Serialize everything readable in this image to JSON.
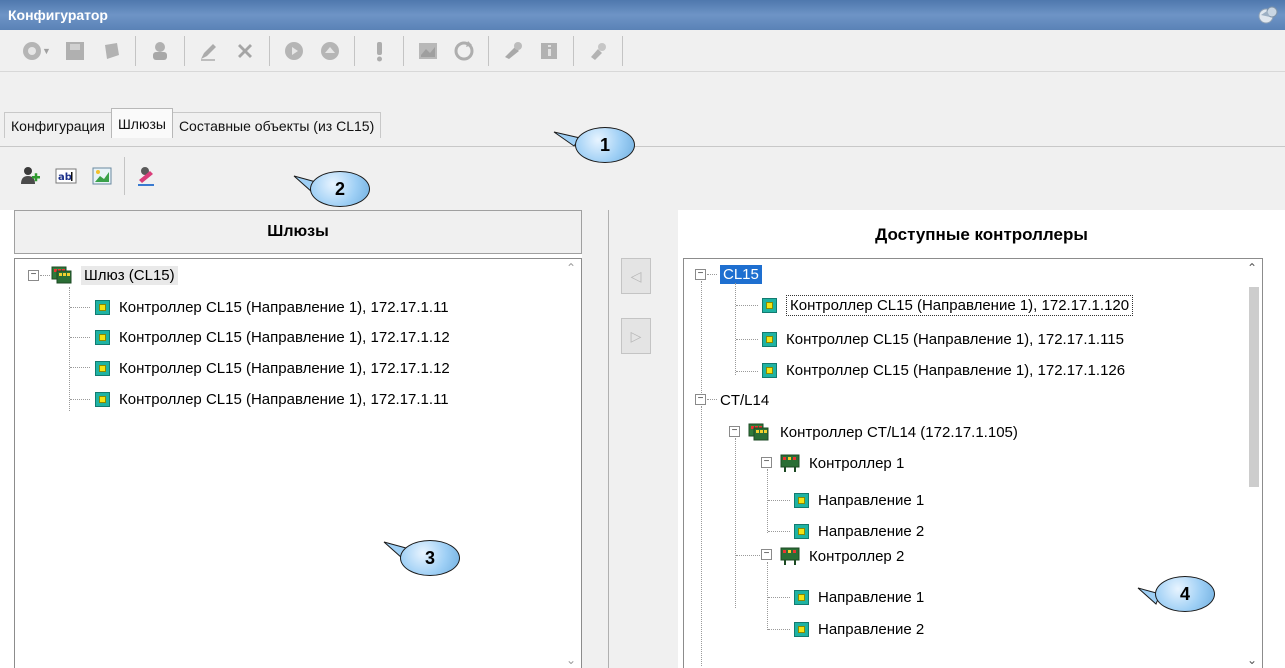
{
  "window": {
    "title": "Конфигуратор"
  },
  "toolbar": {
    "icons": [
      "add-controller-icon",
      "dropdown-arrow-icon",
      "save-icon",
      "connect-icon",
      "add-user-icon",
      "edit-icon",
      "delete-icon",
      "play-icon",
      "eject-icon",
      "alert-icon",
      "map-icon",
      "refresh-icon",
      "key-icon",
      "info-icon",
      "settings-icon"
    ]
  },
  "tabs": [
    {
      "label": "Конфигурация",
      "active": false
    },
    {
      "label": "Шлюзы",
      "active": true
    },
    {
      "label": "Составные объекты (из CL15)",
      "active": false
    }
  ],
  "subtoolbar": {
    "icons": [
      "add-gateway-icon",
      "rename-icon",
      "properties-icon",
      "edit-icon"
    ]
  },
  "left_panel": {
    "header": "Шлюзы",
    "root": {
      "label": "Шлюз (CL15)",
      "expanded": true
    },
    "items": [
      "Контроллер CL15 (Направление 1), 172.17.1.11",
      "Контроллер CL15 (Направление 1), 172.17.1.12",
      "Контроллер CL15 (Направление 1), 172.17.1.12",
      "Контроллер CL15 (Направление 1), 172.17.1.11"
    ]
  },
  "move_buttons": {
    "left": "◁",
    "right": "▷"
  },
  "right_panel": {
    "header": "Доступные контроллеры",
    "groups": [
      {
        "label": "CL15",
        "selected": true,
        "items": [
          "Контроллер CL15 (Направление 1), 172.17.1.120",
          "Контроллер CL15 (Направление 1), 172.17.1.115",
          "Контроллер CL15 (Направление 1), 172.17.1.126"
        ]
      },
      {
        "label": "CT/L14",
        "controller": "Контроллер CT/L14 (172.17.1.105)",
        "subcontrollers": [
          {
            "label": "Контроллер 1",
            "directions": [
              "Направление 1",
              "Направление 2"
            ]
          },
          {
            "label": "Контроллер 2",
            "directions": [
              "Направление 1",
              "Направление 2"
            ]
          }
        ]
      }
    ]
  },
  "callouts": [
    "1",
    "2",
    "3",
    "4"
  ],
  "colors": {
    "titlebar": "#5a82b6",
    "selection": "#1e6fd0",
    "callout": "#9ecff5",
    "controller_icon": "#1fb3a3"
  }
}
